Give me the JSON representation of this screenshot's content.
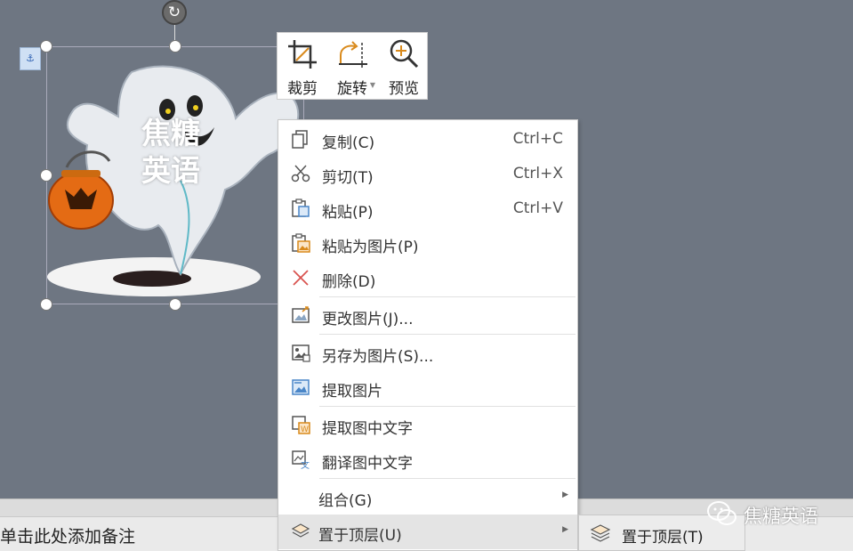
{
  "picture": {
    "watermark_text_line1": "焦糖",
    "watermark_text_line2": "英语"
  },
  "mini_toolbar": {
    "crop_label": "裁剪",
    "rotate_label": "旋转",
    "preview_label": "预览"
  },
  "context_menu": {
    "items": [
      {
        "label": "复制(C)",
        "shortcut": "Ctrl+C",
        "icon": "copy-icon"
      },
      {
        "label": "剪切(T)",
        "shortcut": "Ctrl+X",
        "icon": "scissors-icon"
      },
      {
        "label": "粘贴(P)",
        "shortcut": "Ctrl+V",
        "icon": "paste-icon"
      },
      {
        "label": "粘贴为图片(P)",
        "icon": "paste-as-picture-icon"
      },
      {
        "label": "删除(D)",
        "icon": "delete-icon"
      },
      {
        "label": "更改图片(J)...",
        "icon": "change-picture-icon"
      },
      {
        "label": "另存为图片(S)...",
        "icon": "save-as-picture-icon"
      },
      {
        "label": "提取图片",
        "icon": "extract-picture-icon"
      },
      {
        "label": "提取图中文字",
        "icon": "extract-text-icon"
      },
      {
        "label": "翻译图中文字",
        "icon": "translate-text-icon"
      },
      {
        "label": "组合(G)",
        "icon": "group-icon"
      },
      {
        "label": "置于顶层(U)",
        "icon": "bring-to-front-icon"
      }
    ]
  },
  "submenu": {
    "label": "置于顶层(T)",
    "icon": "bring-to-front-icon"
  },
  "notes": {
    "placeholder": "单击此处添加备注"
  },
  "watermark": {
    "text": "焦糖英语",
    "icon": "wechat-icon"
  },
  "colors": {
    "canvas_background": "#6e7682",
    "menu_highlight": "#e4e4e4",
    "notes_background": "#eaeaea"
  }
}
